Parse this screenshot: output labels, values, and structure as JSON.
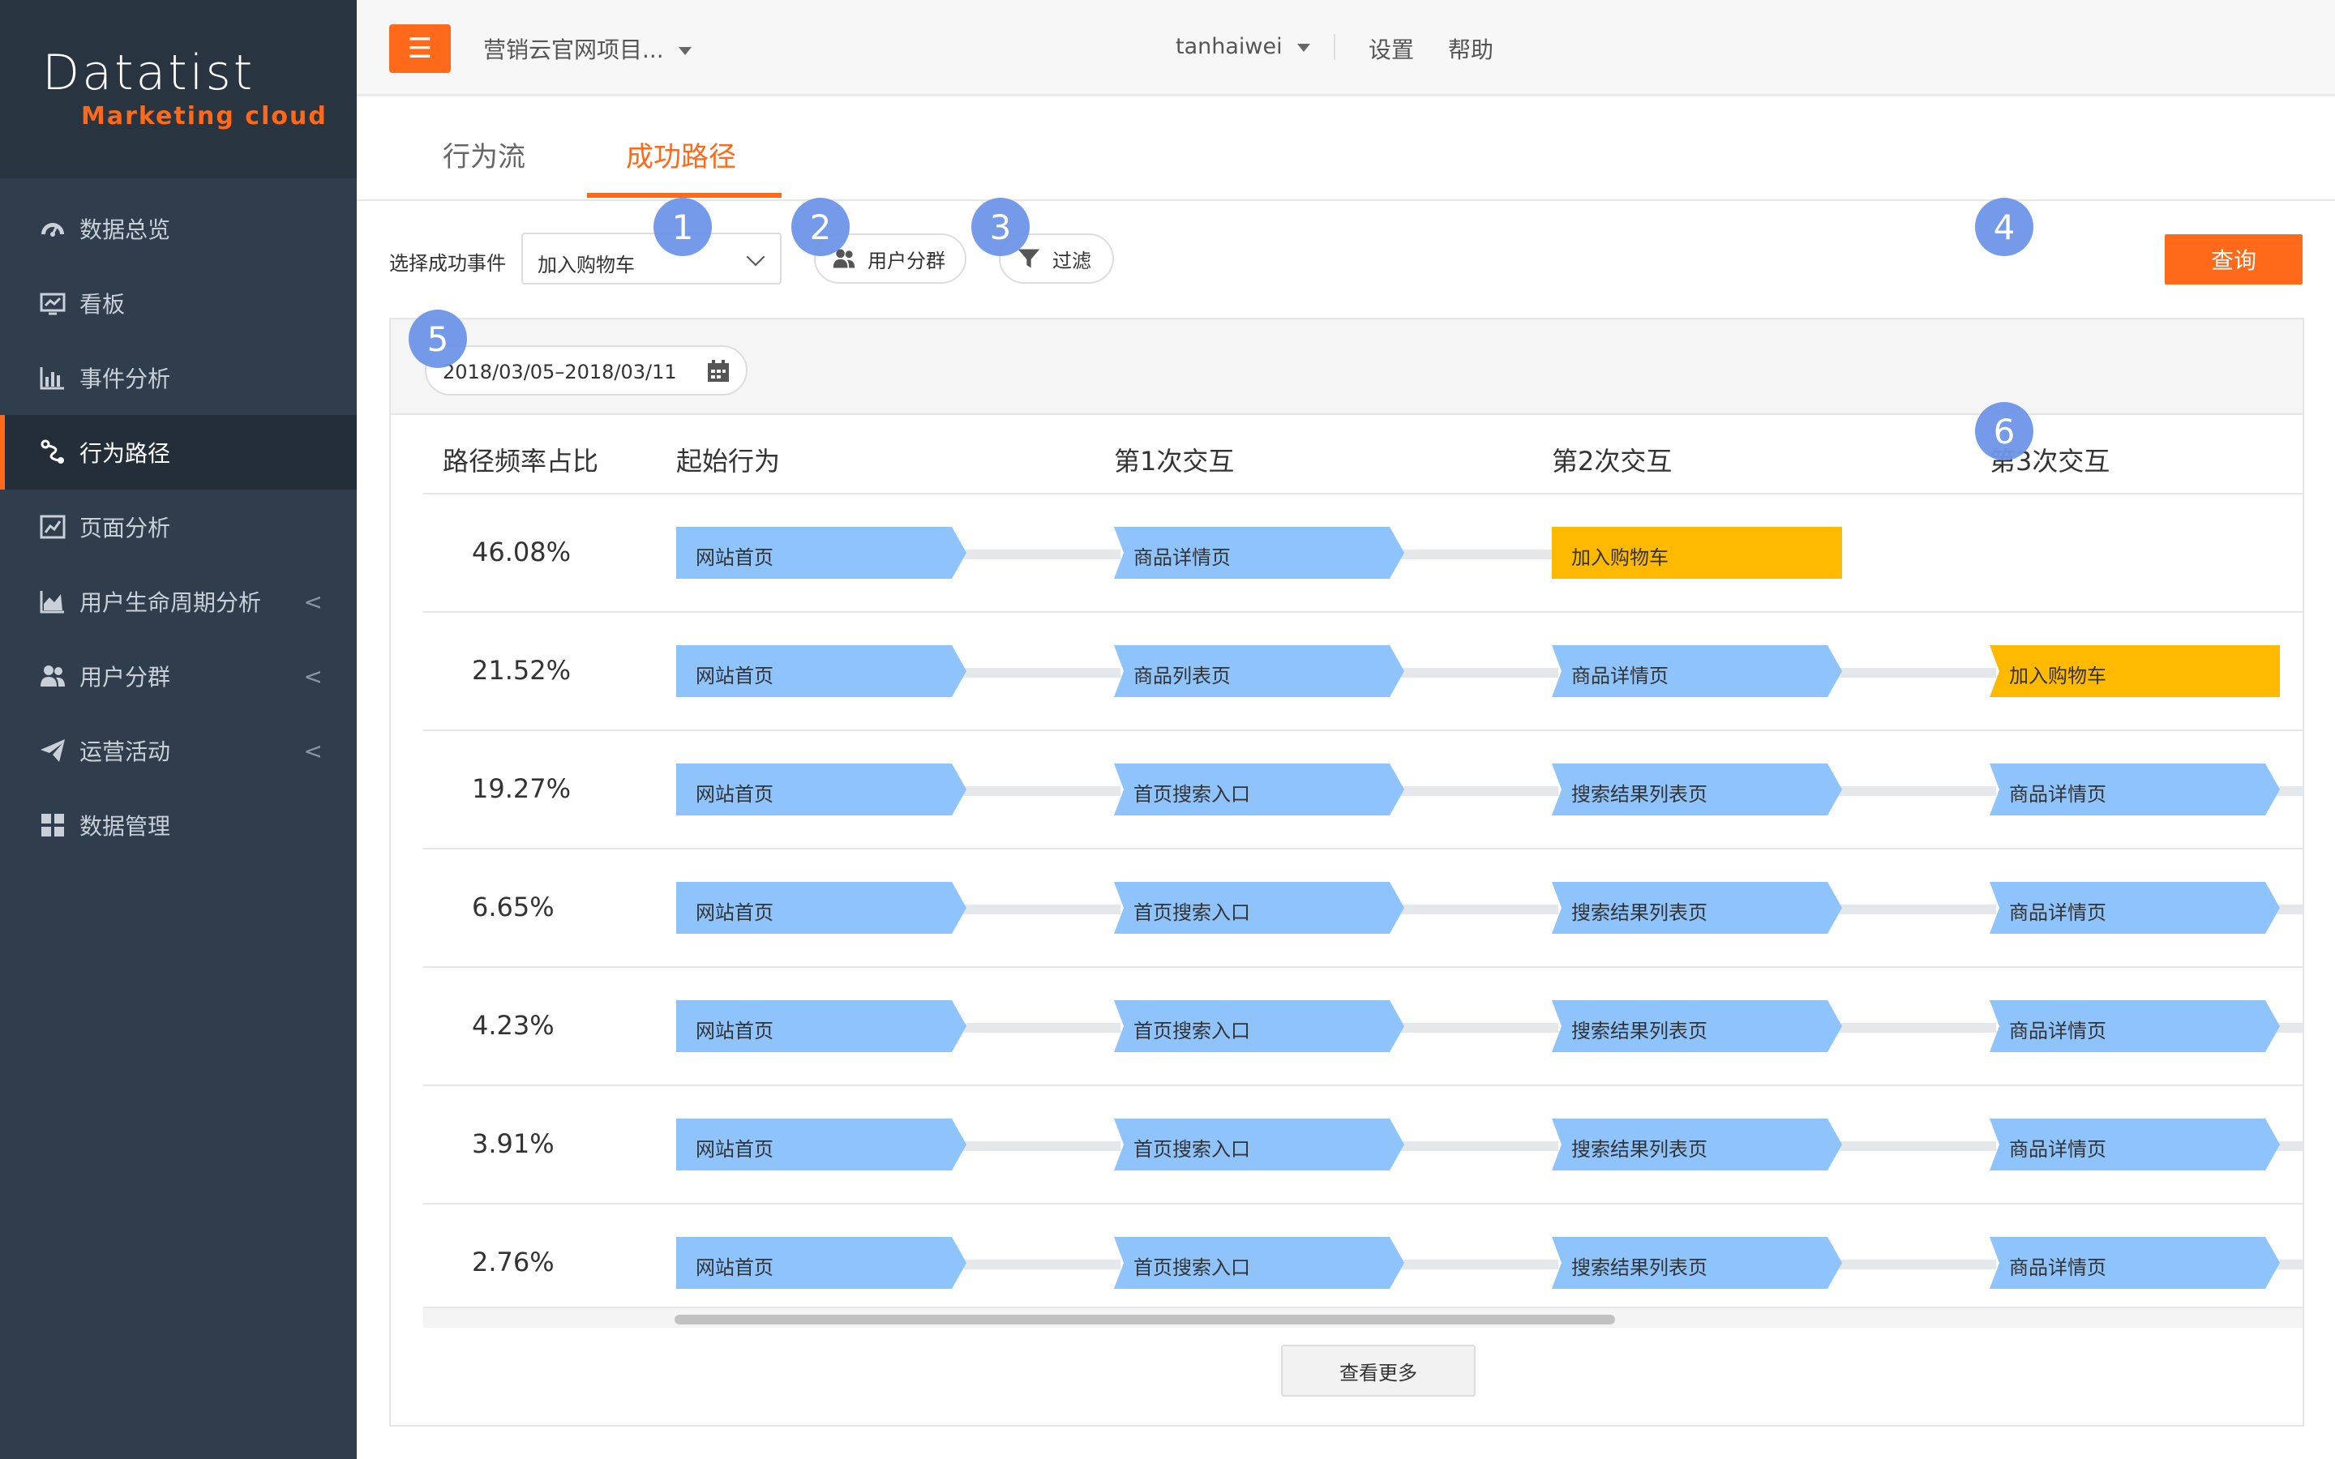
{
  "app": {
    "logo_main": "Datatist",
    "logo_sub": "Marketing cloud"
  },
  "sidebar": {
    "items": [
      {
        "label": "数据总览",
        "icon": "dashboard-icon"
      },
      {
        "label": "看板",
        "icon": "board-icon"
      },
      {
        "label": "事件分析",
        "icon": "bar-chart-icon"
      },
      {
        "label": "行为路径",
        "icon": "path-icon",
        "active": true
      },
      {
        "label": "页面分析",
        "icon": "page-chart-icon"
      },
      {
        "label": "用户生命周期分析",
        "icon": "area-chart-icon",
        "chevron": "<"
      },
      {
        "label": "用户分群",
        "icon": "users-icon",
        "chevron": "<"
      },
      {
        "label": "运营活动",
        "icon": "send-icon",
        "chevron": "<"
      },
      {
        "label": "数据管理",
        "icon": "grid-icon"
      }
    ]
  },
  "topbar": {
    "menu_glyph": "☰",
    "project": "营销云官网项目...",
    "user": "tanhaiwei",
    "settings": "设置",
    "help": "帮助"
  },
  "tabs": [
    {
      "label": "行为流",
      "active": false
    },
    {
      "label": "成功路径",
      "active": true
    }
  ],
  "filters": {
    "event_label": "选择成功事件",
    "event_value": "加入购物车",
    "segment_label": "用户分群",
    "filter_label": "过滤",
    "query_label": "查询"
  },
  "date_range": "2018/03/05–2018/03/11",
  "badges": [
    "1",
    "2",
    "3",
    "4",
    "5",
    "6"
  ],
  "table": {
    "headers": [
      "路径频率占比",
      "起始行为",
      "第1次交互",
      "第2次交互",
      "第3次交互"
    ],
    "rows": [
      {
        "pct": "46.08%",
        "steps": [
          "网站首页",
          "商品详情页",
          "加入购物车"
        ]
      },
      {
        "pct": "21.52%",
        "steps": [
          "网站首页",
          "商品列表页",
          "商品详情页",
          "加入购物车"
        ]
      },
      {
        "pct": "19.27%",
        "steps": [
          "网站首页",
          "首页搜索入口",
          "搜索结果列表页",
          "商品详情页"
        ]
      },
      {
        "pct": "6.65%",
        "steps": [
          "网站首页",
          "首页搜索入口",
          "搜索结果列表页",
          "商品详情页"
        ]
      },
      {
        "pct": "4.23%",
        "steps": [
          "网站首页",
          "首页搜索入口",
          "搜索结果列表页",
          "商品详情页"
        ]
      },
      {
        "pct": "3.91%",
        "steps": [
          "网站首页",
          "首页搜索入口",
          "搜索结果列表页",
          "商品详情页"
        ]
      },
      {
        "pct": "2.76%",
        "steps": [
          "网站首页",
          "首页搜索入口",
          "搜索结果列表页",
          "商品详情页"
        ]
      }
    ]
  },
  "more_label": "查看更多",
  "colors": {
    "accent": "#ff6a1a",
    "sidebar": "#2f3d4c",
    "step": "#8ec3fb",
    "goal": "#ffba00",
    "badge": "#6e95e8"
  }
}
